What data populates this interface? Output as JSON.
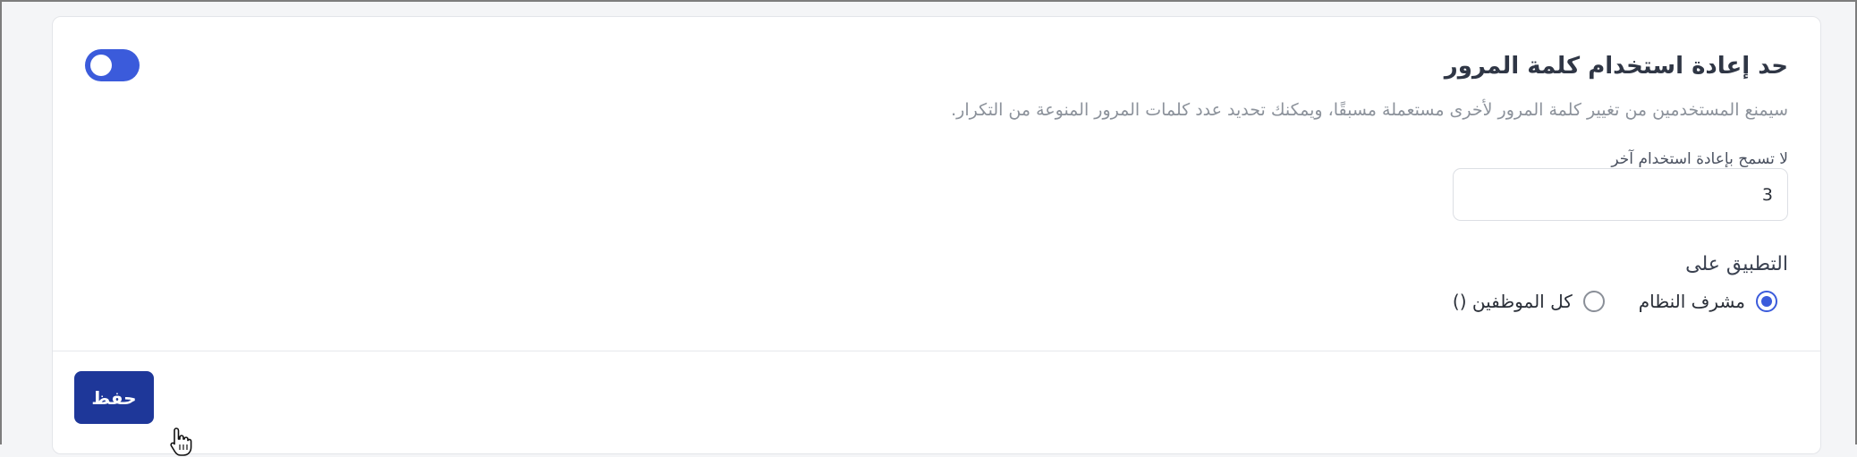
{
  "policy": {
    "title": "حد إعادة استخدام كلمة المرور",
    "description": "سيمنع المستخدمين من تغيير كلمة المرور لأخرى مستعملة مسبقًا، ويمكنك تحديد عدد كلمات المرور المنوعة من التكرار.",
    "enabled": true,
    "toggle_color": "#3b5bdb"
  },
  "reuse_field": {
    "label": "لا تسمح بإعادة استخدام آخر",
    "value": "3"
  },
  "apply_to": {
    "label": "التطبيق على",
    "options": [
      {
        "label": "مشرف النظام",
        "checked": true
      },
      {
        "label": "كل الموظفين ()",
        "checked": false
      }
    ]
  },
  "footer": {
    "save_label": "حفظ",
    "button_color": "#1e3799"
  },
  "cursor": {
    "icon": "hand-pointer-icon"
  }
}
